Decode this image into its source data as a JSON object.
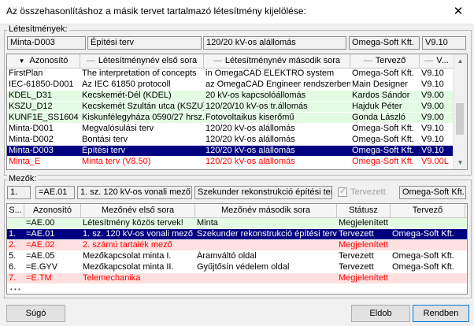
{
  "window": {
    "title": "Az összehasonlításhoz a másik tervet tartalmazó létesítmény kijelölése:",
    "close": "✕"
  },
  "facilities": {
    "group_label": "Létesítmények:",
    "top_fields": [
      "Minta-D003",
      "Építési terv",
      "120/20 kV-os alállomás",
      "Omega-Soft Kft.",
      "V9.10"
    ],
    "columns": [
      "Azonosító",
      "Létesítménynév első sora",
      "Létesítménynév második sora",
      "Tervező",
      "V..."
    ],
    "rows": [
      {
        "cells": [
          "FirstPlan",
          "The interpretation of concepts",
          "in OmegaCAD ELEKTRO system",
          "Omega-Soft Kft.",
          "V9.10"
        ],
        "style": ""
      },
      {
        "cells": [
          "IEC-61850-D001",
          "Az IEC 61850 protocoll",
          "az OmegaCAD Engineer rendszerben",
          "Main Designer",
          "V9.10"
        ],
        "style": ""
      },
      {
        "cells": [
          "KDEL_D31",
          "Kecskemét-Dél (KDEL)",
          "20 kV-os kapcsolóállomás",
          "Kardos Sándor",
          "V9.00"
        ],
        "style": "green"
      },
      {
        "cells": [
          "KSZU_D12",
          "Kecskemét Szultán utca (KSZU)",
          "120/20/10 kV-os tr.állomás",
          "Hajduk Péter",
          "V9.00"
        ],
        "style": "green"
      },
      {
        "cells": [
          "KUNF1E_SS1604",
          "Kiskunfélegyháza 0590/27 hrsz.",
          "Fotovoltaikus kiserőmű",
          "Gonda László",
          "V9.00"
        ],
        "style": "green"
      },
      {
        "cells": [
          "Minta-D001",
          "Megvalósulási terv",
          "120/20 kV-os alállomás",
          "Omega-Soft Kft.",
          "V9.10"
        ],
        "style": ""
      },
      {
        "cells": [
          "Minta-D002",
          "Bontási terv",
          "120/20 kV-os alállomás",
          "Omega-Soft Kft.",
          "V9.10"
        ],
        "style": ""
      },
      {
        "cells": [
          "Minta-D003",
          "Építési terv",
          "120/20 kV-os alállomás",
          "Omega-Soft Kft.",
          "V9.10"
        ],
        "style": "sel"
      },
      {
        "cells": [
          "Minta_E",
          "Minta terv (V8.50)",
          "120/20 kV-os alállomás",
          "Omega-Soft Kft.",
          "V9.00L"
        ],
        "style": "red"
      }
    ]
  },
  "fields": {
    "group_label": "Mezők:",
    "top_fields": [
      "1.",
      "=AE.01",
      "1. sz. 120 kV-os vonali mező",
      "Szekunder rekonstrukció építési terv"
    ],
    "tervezett_label": "Tervezett",
    "company": "Omega-Soft Kft.",
    "columns": [
      "S...",
      "Azonosító",
      "Mezőnév első sora",
      "Mezőnév második sora",
      "Státusz",
      "Tervező"
    ],
    "rows": [
      {
        "cells": [
          "",
          "=AE.00",
          "Létesítmény közös tervek!",
          "Minta",
          "Megjelenített",
          ""
        ],
        "style": "green"
      },
      {
        "cells": [
          "1.",
          "=AE.01",
          "1. sz. 120 kV-os vonali mező",
          "Szekunder rekonstrukció építési terv",
          "Tervezett",
          "Omega-Soft Kft."
        ],
        "style": "sel"
      },
      {
        "cells": [
          "2.",
          "=AE.02",
          "2. számú tartalék mező",
          "",
          "Megjelenített",
          ""
        ],
        "style": "pinkred"
      },
      {
        "cells": [
          "5.",
          "=AE.05",
          "Mezőkapcsolat minta I.",
          "Áramváltó oldal",
          "Tervezett",
          "Omega-Soft Kft."
        ],
        "style": ""
      },
      {
        "cells": [
          "6.",
          "=E.GYV",
          "Mezőkapcsolat minta II.",
          "Gyűjtősín védelem oldal",
          "Tervezett",
          "Omega-Soft Kft."
        ],
        "style": ""
      },
      {
        "cells": [
          "7.",
          "=E.TM",
          "Telemechanika",
          "",
          "Megjelenített",
          ""
        ],
        "style": "pinkred"
      }
    ],
    "more": "• • •"
  },
  "buttons": {
    "help": "Súgó",
    "compare": "Eldob",
    "ok": "Rendben"
  },
  "colors": {
    "selection": "#000080",
    "green_row": "#e3fbe3",
    "pink_row": "#ffe0e0",
    "red_text": "#ff0000"
  }
}
